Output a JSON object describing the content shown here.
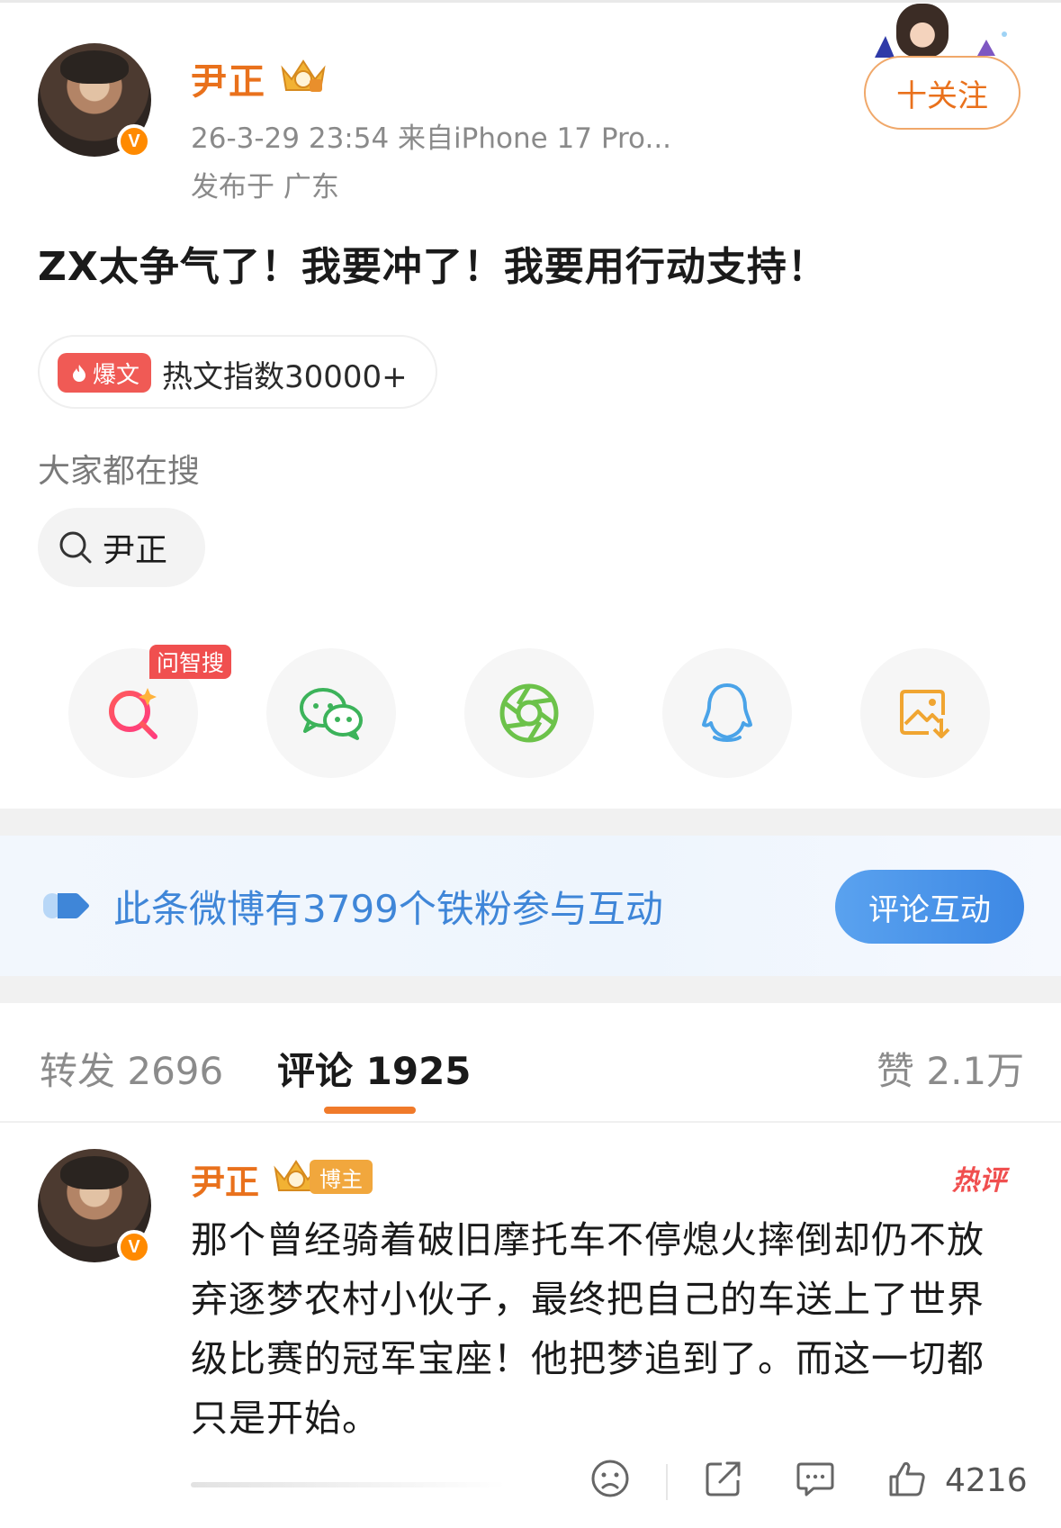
{
  "post": {
    "author": "尹正",
    "time_source": "26-3-29 23:54  来自iPhone 17 Pro...",
    "location": "发布于 广东",
    "follow_label": "十关注",
    "text": "ZX太争气了！我要冲了！我要用行动支持！",
    "hot_tag": "爆文",
    "hot_index": "热文指数30000+"
  },
  "search": {
    "title": "大家都在搜",
    "chip": "尹正"
  },
  "share": {
    "ask_tag": "问智搜",
    "buttons": [
      "smart-search-icon",
      "wechat-icon",
      "moments-icon",
      "qq-icon",
      "save-image-icon"
    ]
  },
  "fan_banner": {
    "text": "此条微博有3799个铁粉参与互动",
    "button": "评论互动"
  },
  "tabs": {
    "repost": "转发 2696",
    "comment": "评论 1925",
    "like": "赞 2.1万"
  },
  "comment": {
    "author": "尹正",
    "badge": "博主",
    "hot_label": "热评",
    "text": "那个曾经骑着破旧摩托车不停熄火摔倒却仍不放弃逐梦农村小伙子，最终把自己的车送上了世界级比赛的冠军宝座！他把梦追到了。而这一切都只是开始。",
    "likes": "4216"
  },
  "colors": {
    "accent_orange": "#e9711c",
    "link_blue": "#3f86d8",
    "hot_red": "#f04f4f"
  }
}
